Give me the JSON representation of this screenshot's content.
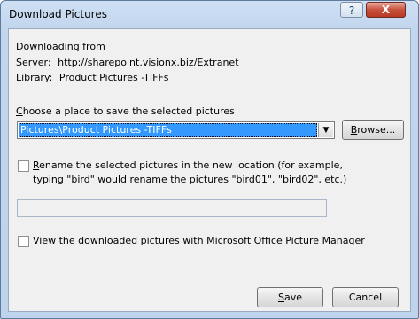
{
  "window": {
    "title": "Download Pictures",
    "help_glyph": "?",
    "close_glyph": "X"
  },
  "source": {
    "heading": "Downloading from",
    "server_label": "Server:",
    "server_value": "http://sharepoint.visionx.biz/Extranet",
    "library_label": "Library:",
    "library_value": "Product Pictures -TIFFs"
  },
  "location": {
    "label_prefix": "",
    "label_accel": "C",
    "label_rest": "hoose a place to save the selected pictures",
    "selected_value": "Pictures\\Product Pictures -TIFFs",
    "browse_accel": "B",
    "browse_rest": "rowse..."
  },
  "rename": {
    "checked": false,
    "label_accel": "R",
    "label_line1_rest": "ename the selected pictures in the new location (for example,",
    "label_line2": "typing \"bird\" would rename the pictures \"bird01\", \"bird02\", etc.)",
    "input_value": ""
  },
  "view": {
    "checked": false,
    "label_accel": "V",
    "label_rest": "iew the downloaded pictures with Microsoft Office Picture Manager"
  },
  "buttons": {
    "save_accel": "S",
    "save_rest": "ave",
    "cancel": "Cancel"
  }
}
